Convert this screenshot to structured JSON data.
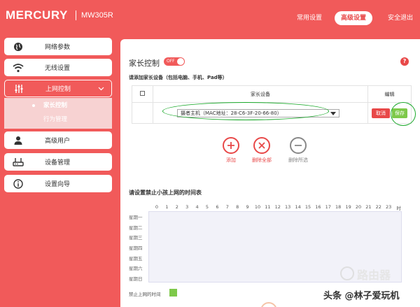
{
  "header": {
    "brand": "MERCURY",
    "model": "MW305R",
    "nav": {
      "basic_settings": "常用设置",
      "advanced_settings": "高级设置",
      "logout": "安全退出"
    }
  },
  "sidebar": {
    "items": [
      {
        "label": "网络参数",
        "icon": "globe-icon"
      },
      {
        "label": "无线设置",
        "icon": "wifi-icon"
      },
      {
        "label": "上网控制",
        "icon": "sliders-icon",
        "active": true
      },
      {
        "label": "高级用户",
        "icon": "user-icon"
      },
      {
        "label": "设备管理",
        "icon": "router-icon"
      },
      {
        "label": "设置向导",
        "icon": "info-icon"
      }
    ],
    "submenu": {
      "active_label": "家长控制",
      "other_label": "行为管理"
    }
  },
  "main": {
    "title": "家长控制",
    "toggle_label": "OFF",
    "help_label": "?",
    "add_device_hint": "请添加家长设备（包括电脑、手机、Pad等）",
    "table": {
      "col_device": "家长设备",
      "col_edit": "编辑",
      "row_device_value": "摄者主机（MAC地址：28-C6-3F-20-66-80）",
      "cancel_label": "取消",
      "save_label": "保存"
    },
    "actions": {
      "add": "添加",
      "delete_all": "删除全部",
      "delete_selected": "删除所选"
    },
    "schedule": {
      "title": "请设置禁止小孩上网的时间表",
      "hours": [
        "0",
        "1",
        "2",
        "3",
        "4",
        "5",
        "6",
        "7",
        "8",
        "9",
        "10",
        "11",
        "12",
        "13",
        "14",
        "15",
        "16",
        "17",
        "18",
        "19",
        "20",
        "21",
        "22",
        "23",
        "时"
      ],
      "days": [
        "星期一",
        "星期二",
        "星期三",
        "星期四",
        "星期五",
        "星期六",
        "星期日"
      ],
      "legend": "禁止上网的时间"
    }
  },
  "watermark": {
    "logo_text": "路由器",
    "credit": "头条 @林子爱玩机"
  },
  "colors": {
    "brand_red": "#f15a5a",
    "save_green": "#7ec94a",
    "highlight_green": "#1aa92a"
  }
}
